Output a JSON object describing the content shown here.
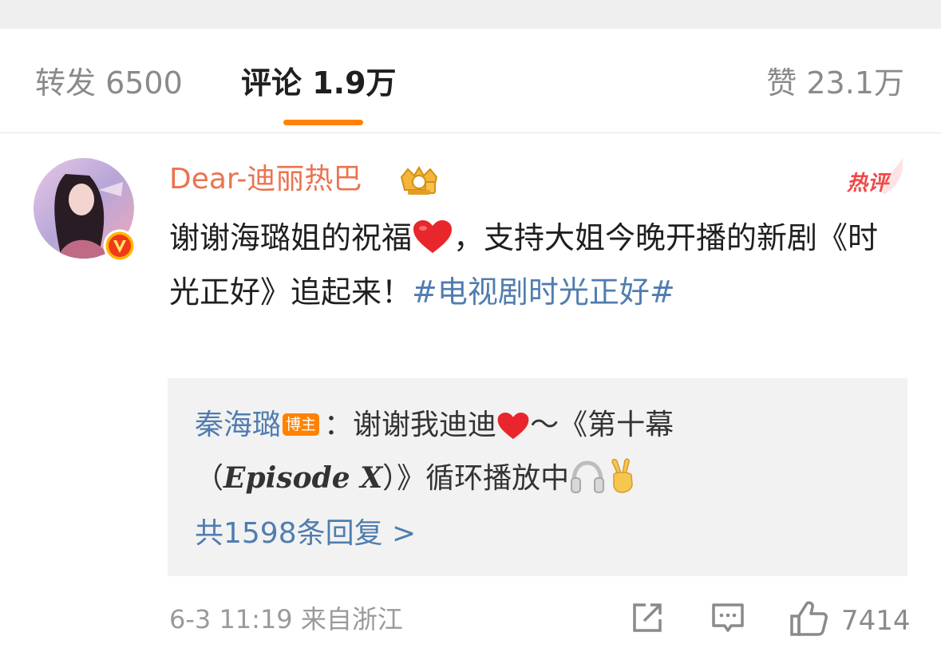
{
  "tabs": {
    "repost": "转发 6500",
    "comment": "评论 1.9万",
    "like": "赞 23.1万"
  },
  "comment": {
    "username": "Dear-迪丽热巴",
    "hot_label": "热评",
    "text_before_heart": "谢谢海璐姐的祝福",
    "text_after_heart": "，支持大姐今晚开播的新剧《时光正好》追起来！",
    "topic": "#电视剧时光正好#",
    "timestamp": "6-3 11:19",
    "location": "来自浙江",
    "like_count": "7414",
    "icons": [
      "verified-v-icon",
      "crown-badge-icon",
      "heart-emoji",
      "share-icon",
      "comment-icon",
      "thumbs-up-icon"
    ]
  },
  "reply": {
    "author": "秦海璐",
    "author_badge": "博主",
    "colon": "：",
    "text1": "谢谢我迪迪",
    "text2": "～《第十幕",
    "text3_open": "（",
    "episode": "Episode X",
    "text3_close": "）》循环播放中",
    "more": "共1598条回复 >",
    "icons": [
      "heart-emoji",
      "headphones-emoji",
      "victory-hand-emoji"
    ]
  },
  "colors": {
    "accent_orange": "#ff8200",
    "username_orange": "#eb7350",
    "link_blue": "#507daf",
    "heart_red": "#e8262c"
  }
}
